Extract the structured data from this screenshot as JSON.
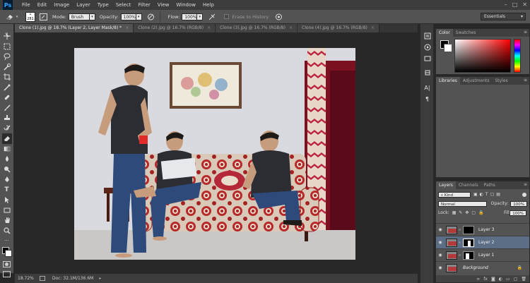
{
  "app": {
    "logo": "Ps"
  },
  "menu": [
    "File",
    "Edit",
    "Image",
    "Layer",
    "Type",
    "Select",
    "Filter",
    "View",
    "Window",
    "Help"
  ],
  "window_controls": [
    "–",
    "□",
    "✕"
  ],
  "options": {
    "brush_size": "281",
    "mode_label": "Mode:",
    "mode_value": "Brush",
    "opacity_label": "Opacity:",
    "opacity_value": "100%",
    "flow_label": "Flow:",
    "flow_value": "100%",
    "erase_to_history": "Erase to History",
    "workspace": "Essentials"
  },
  "tabs": [
    {
      "label": "Clone (1).jpg @ 18.7% (Layer 2, Layer Mask/8) *",
      "active": true
    },
    {
      "label": "Clone (2).jpg @ 16.7% (RGB/8)",
      "active": false
    },
    {
      "label": "Clone (3).jpg @ 16.7% (RGB/8)",
      "active": false
    },
    {
      "label": "Clone (4).jpg @ 16.7% (RGB/8)",
      "active": false
    }
  ],
  "tab_close": "×",
  "status": {
    "zoom": "18.72%",
    "doc": "Doc: 32.1M/136.6M"
  },
  "panels": {
    "color_tabs": [
      "Color",
      "Swatches"
    ],
    "library_tabs": [
      "Libraries",
      "Adjustments",
      "Styles"
    ],
    "layers_tabs": [
      "Layers",
      "Channels",
      "Paths"
    ],
    "kind": "Kind",
    "blend_mode": "Normal",
    "opacity_label": "Opacity:",
    "opacity_value": "100%",
    "lock_label": "Lock:",
    "fill_label": "Fill:",
    "fill_value": "100%",
    "layers": [
      {
        "name": "Layer 3",
        "selected": false,
        "mask": true
      },
      {
        "name": "Layer 2",
        "selected": true,
        "mask": true
      },
      {
        "name": "Layer 1",
        "selected": false,
        "mask": true
      },
      {
        "name": "Background",
        "selected": false,
        "mask": false
      }
    ]
  },
  "colors": {
    "foreground": "#000000",
    "background": "#ffffff",
    "selected_layer": "#5c6d86",
    "accent": "#31a8ff"
  }
}
